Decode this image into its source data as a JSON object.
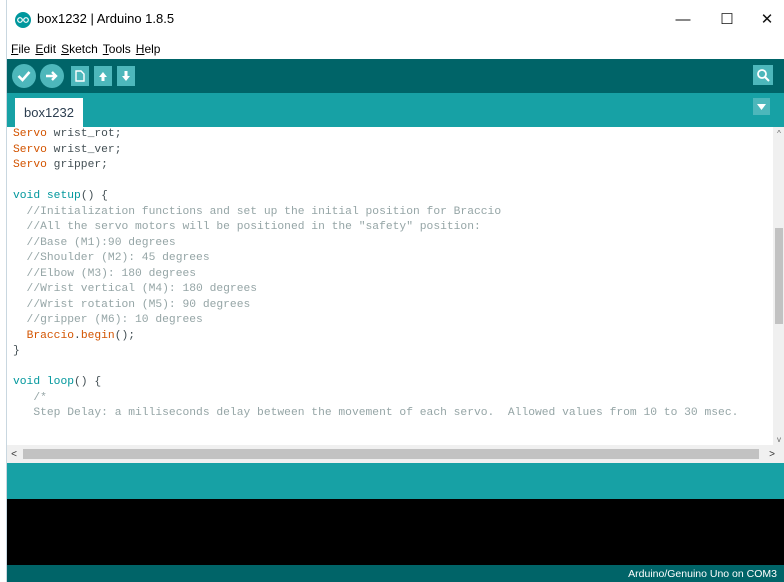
{
  "window": {
    "title": "box1232 | Arduino 1.8.5",
    "minimize": "—",
    "maximize": "☐",
    "close": "✕"
  },
  "menu": {
    "items": [
      {
        "first": "F",
        "rest": "ile"
      },
      {
        "first": "E",
        "rest": "dit"
      },
      {
        "first": "S",
        "rest": "ketch"
      },
      {
        "first": "T",
        "rest": "ools"
      },
      {
        "first": "H",
        "rest": "elp"
      }
    ]
  },
  "toolbar": {
    "buttons": [
      "verify-icon",
      "upload-icon",
      "new-icon",
      "open-icon",
      "save-icon"
    ],
    "serial_monitor": "serial-monitor-icon"
  },
  "tabs": [
    {
      "label": "box1232"
    }
  ],
  "editor": {
    "lines": [
      [
        {
          "t": "Servo",
          "c": "kw-type"
        },
        {
          "t": " wrist_rot;"
        }
      ],
      [
        {
          "t": "Servo",
          "c": "kw-type"
        },
        {
          "t": " wrist_ver;"
        }
      ],
      [
        {
          "t": "Servo",
          "c": "kw-type"
        },
        {
          "t": " gripper;"
        }
      ],
      [
        {
          "t": ""
        }
      ],
      [
        {
          "t": "void",
          "c": "kw-ctrl"
        },
        {
          "t": " "
        },
        {
          "t": "setup",
          "c": "kw-ctrl"
        },
        {
          "t": "() {"
        }
      ],
      [
        {
          "t": "  //Initialization functions and set up the initial position for Braccio",
          "c": "comment"
        }
      ],
      [
        {
          "t": "  //All the servo motors will be positioned in the \"safety\" position:",
          "c": "comment"
        }
      ],
      [
        {
          "t": "  //Base (M1):90 degrees",
          "c": "comment"
        }
      ],
      [
        {
          "t": "  //Shoulder (M2): 45 degrees",
          "c": "comment"
        }
      ],
      [
        {
          "t": "  //Elbow (M3): 180 degrees",
          "c": "comment"
        }
      ],
      [
        {
          "t": "  //Wrist vertical (M4): 180 degrees",
          "c": "comment"
        }
      ],
      [
        {
          "t": "  //Wrist rotation (M5): 90 degrees",
          "c": "comment"
        }
      ],
      [
        {
          "t": "  //gripper (M6): 10 degrees",
          "c": "comment"
        }
      ],
      [
        {
          "t": "  "
        },
        {
          "t": "Braccio",
          "c": "kw-fn"
        },
        {
          "t": "."
        },
        {
          "t": "begin",
          "c": "kw-fn"
        },
        {
          "t": "();"
        }
      ],
      [
        {
          "t": "}"
        }
      ],
      [
        {
          "t": ""
        }
      ],
      [
        {
          "t": "void",
          "c": "kw-ctrl"
        },
        {
          "t": " "
        },
        {
          "t": "loop",
          "c": "kw-ctrl"
        },
        {
          "t": "() {"
        }
      ],
      [
        {
          "t": "   /*",
          "c": "comment"
        }
      ],
      [
        {
          "t": "   Step Delay: a milliseconds delay between the movement of each servo.  Allowed values from 10 to 30 msec.",
          "c": "comment"
        }
      ]
    ]
  },
  "status": {
    "board": "Arduino/Genuino Uno on COM3"
  },
  "colors": {
    "toolbar": "#006468",
    "tabstrip": "#17a1a5",
    "button": "#4db7bb",
    "keyword_type": "#d35400",
    "keyword_ctrl": "#00979c",
    "comment": "#95a5a6"
  }
}
